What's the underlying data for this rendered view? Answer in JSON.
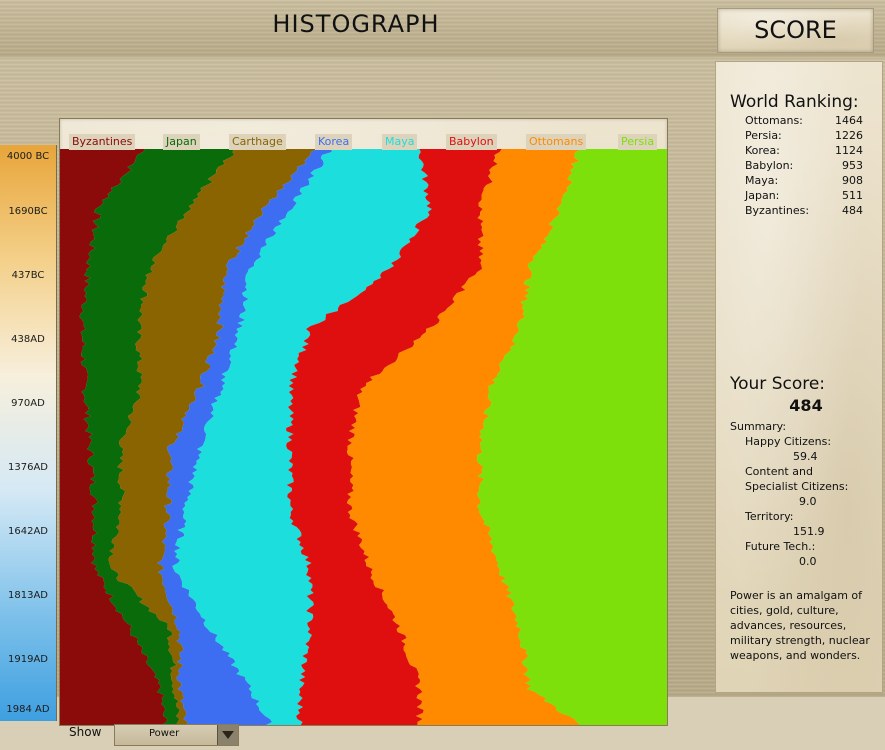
{
  "header": {
    "title": "HISTOGRAPH",
    "score_tab": "SCORE"
  },
  "timeline": [
    "4000 BC",
    "1690BC",
    "437BC",
    "438AD",
    "970AD",
    "1376AD",
    "1642AD",
    "1813AD",
    "1919AD",
    "1984 AD"
  ],
  "civilizations": [
    {
      "name": "Byzantines",
      "color": "#8b0a0a"
    },
    {
      "name": "Japan",
      "color": "#0a6b0a"
    },
    {
      "name": "Carthage",
      "color": "#8a6400"
    },
    {
      "name": "Korea",
      "color": "#3d6ef2"
    },
    {
      "name": "Maya",
      "color": "#1bdedd"
    },
    {
      "name": "Babylon",
      "color": "#e00f0f"
    },
    {
      "name": "Ottomans",
      "color": "#ff8a00"
    },
    {
      "name": "Persia",
      "color": "#7de00a"
    }
  ],
  "show": {
    "label": "Show",
    "value": "Power"
  },
  "ranking": {
    "title": "World Ranking:",
    "rows": [
      {
        "name": "Ottomans:",
        "value": "1464"
      },
      {
        "name": "Persia:",
        "value": "1226"
      },
      {
        "name": "Korea:",
        "value": "1124"
      },
      {
        "name": "Babylon:",
        "value": "953"
      },
      {
        "name": "Maya:",
        "value": "908"
      },
      {
        "name": "Japan:",
        "value": "511"
      },
      {
        "name": "Byzantines:",
        "value": "484"
      }
    ]
  },
  "your_score": {
    "title": "Your Score:",
    "value": "484",
    "summary_label": "Summary:",
    "happy_label": "Happy Citizens:",
    "happy_value": "59.4",
    "content_label_1": "Content and",
    "content_label_2": "Specialist Citizens:",
    "content_value": "9.0",
    "territory_label": "Territory:",
    "territory_value": "151.9",
    "future_label": "Future Tech.:",
    "future_value": "0.0"
  },
  "note": "Power is an amalgam of cities, gold, culture, advances, resources, military strength, nuclear weapons, and wonders."
}
